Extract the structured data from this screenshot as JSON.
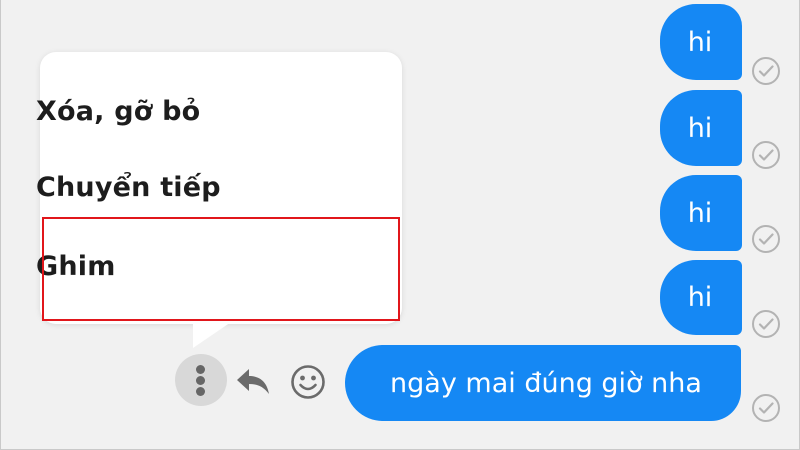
{
  "menu": {
    "items": [
      {
        "label": "Xóa, gỡ bỏ"
      },
      {
        "label": "Chuyển tiếp"
      },
      {
        "label": "Ghim"
      }
    ],
    "highlighted_item": "Ghim",
    "highlight_color": "#e1161b"
  },
  "messages": [
    {
      "text": "hi",
      "status": "sent"
    },
    {
      "text": "hi",
      "status": "sent"
    },
    {
      "text": "hi",
      "status": "sent"
    },
    {
      "text": "hi",
      "status": "sent"
    },
    {
      "text": "ngày mai đúng giờ nha",
      "status": "sent"
    }
  ],
  "message_actions": {
    "icons": [
      "more-options-icon",
      "reply-icon",
      "emoji-icon"
    ]
  },
  "colors": {
    "bubble": "#1588f4",
    "bubble_text": "#ffffff",
    "background": "#f1f1f1",
    "menu_background": "#ffffff",
    "action_icon": "#6b6b6b"
  }
}
